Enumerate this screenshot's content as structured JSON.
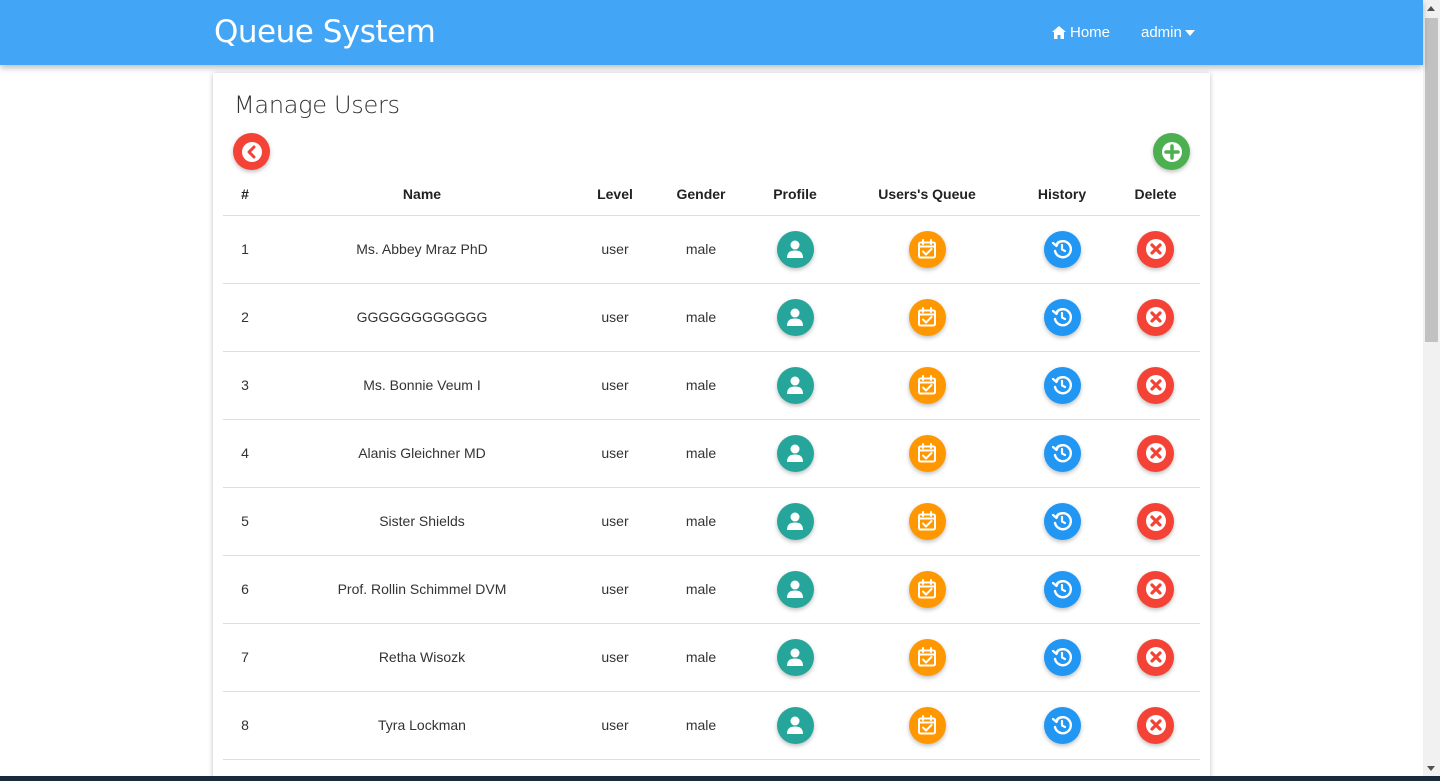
{
  "navbar": {
    "brand": "Queue System",
    "home_label": "Home",
    "user_label": "admin",
    "color": "#42a5f5"
  },
  "page": {
    "title": "Manage Users"
  },
  "table": {
    "headers": [
      "#",
      "Name",
      "Level",
      "Gender",
      "Profile",
      "Users's Queue",
      "History",
      "Delete"
    ],
    "rows": [
      {
        "num": "1",
        "name": "Ms. Abbey Mraz PhD",
        "level": "user",
        "gender": "male"
      },
      {
        "num": "2",
        "name": "GGGGGGGGGGGG",
        "level": "user",
        "gender": "male"
      },
      {
        "num": "3",
        "name": "Ms. Bonnie Veum I",
        "level": "user",
        "gender": "male"
      },
      {
        "num": "4",
        "name": "Alanis Gleichner MD",
        "level": "user",
        "gender": "male"
      },
      {
        "num": "5",
        "name": "Sister Shields",
        "level": "user",
        "gender": "male"
      },
      {
        "num": "6",
        "name": "Prof. Rollin Schimmel DVM",
        "level": "user",
        "gender": "male"
      },
      {
        "num": "7",
        "name": "Retha Wisozk",
        "level": "user",
        "gender": "male"
      },
      {
        "num": "8",
        "name": "Tyra Lockman",
        "level": "user",
        "gender": "male"
      }
    ]
  },
  "icons": {
    "back": "chevron-left-icon",
    "add": "plus-icon",
    "profile": "user-icon",
    "queue": "calendar-check-icon",
    "history": "history-icon",
    "delete": "close-icon"
  },
  "colors": {
    "profile": "#26a69a",
    "queue": "#ff9800",
    "history": "#2196f3",
    "delete": "#f44336",
    "add": "#4caf50"
  }
}
